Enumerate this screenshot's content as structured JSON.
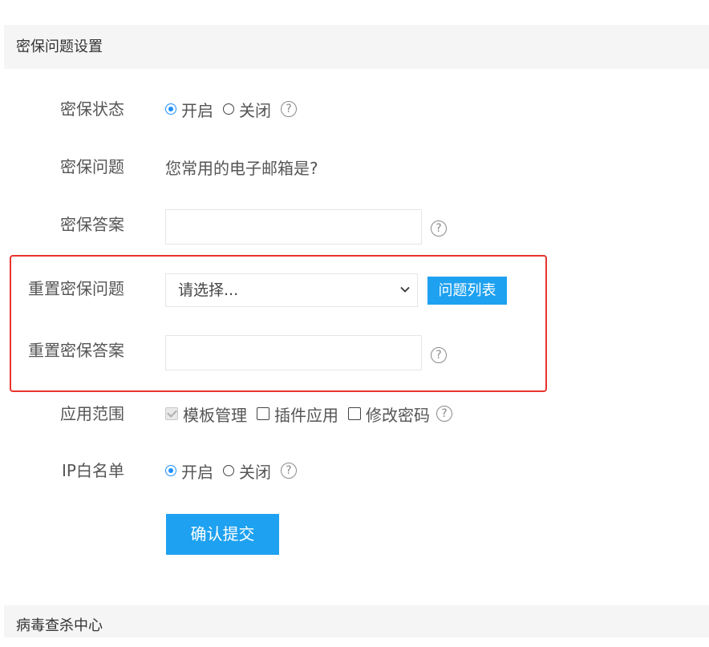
{
  "section1": {
    "title": "密保问题设置"
  },
  "status": {
    "label": "密保状态",
    "options": [
      "开启",
      "关闭"
    ],
    "selected": "开启",
    "help": "?"
  },
  "question": {
    "label": "密保问题",
    "value": "您常用的电子邮箱是?"
  },
  "answer": {
    "label": "密保答案",
    "value": "",
    "help": "?"
  },
  "reset_question": {
    "label": "重置密保问题",
    "select_value": "请选择...",
    "list_button": "问题列表"
  },
  "reset_answer": {
    "label": "重置密保答案",
    "value": "",
    "help": "?"
  },
  "scope": {
    "label": "应用范围",
    "options": [
      {
        "label": "模板管理",
        "checked": true,
        "disabled": true
      },
      {
        "label": "插件应用",
        "checked": false,
        "disabled": false
      },
      {
        "label": "修改密码",
        "checked": false,
        "disabled": false
      }
    ],
    "help": "?"
  },
  "ip_whitelist": {
    "label": "IP白名单",
    "options": [
      "开启",
      "关闭"
    ],
    "selected": "开启",
    "help": "?"
  },
  "submit": {
    "label": "确认提交"
  },
  "section2": {
    "title": "病毒查杀中心"
  },
  "colors": {
    "accent": "#1ea1f0",
    "highlight_border": "#e8352c",
    "header_bg": "#f5f5f5"
  }
}
